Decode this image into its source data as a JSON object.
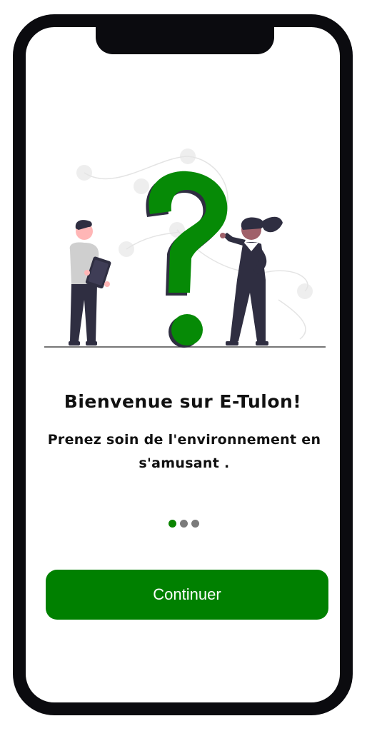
{
  "onboarding": {
    "title": "Bienvenue sur E-Tulon!",
    "subtitle": "Prenez soin de l'environnement en s'amusant .",
    "continue_label": "Continuer",
    "pager": {
      "total_pages": 3,
      "current_page": 1
    },
    "illustration": {
      "description_icons": [
        "person-with-tablet-icon",
        "question-mark-icon",
        "woman-pointing-icon"
      ],
      "accent_color": "#008000"
    }
  },
  "colors": {
    "brand_green": "#008000",
    "dark_figure": "#2f2e41",
    "frame": "#0b0b0f"
  }
}
